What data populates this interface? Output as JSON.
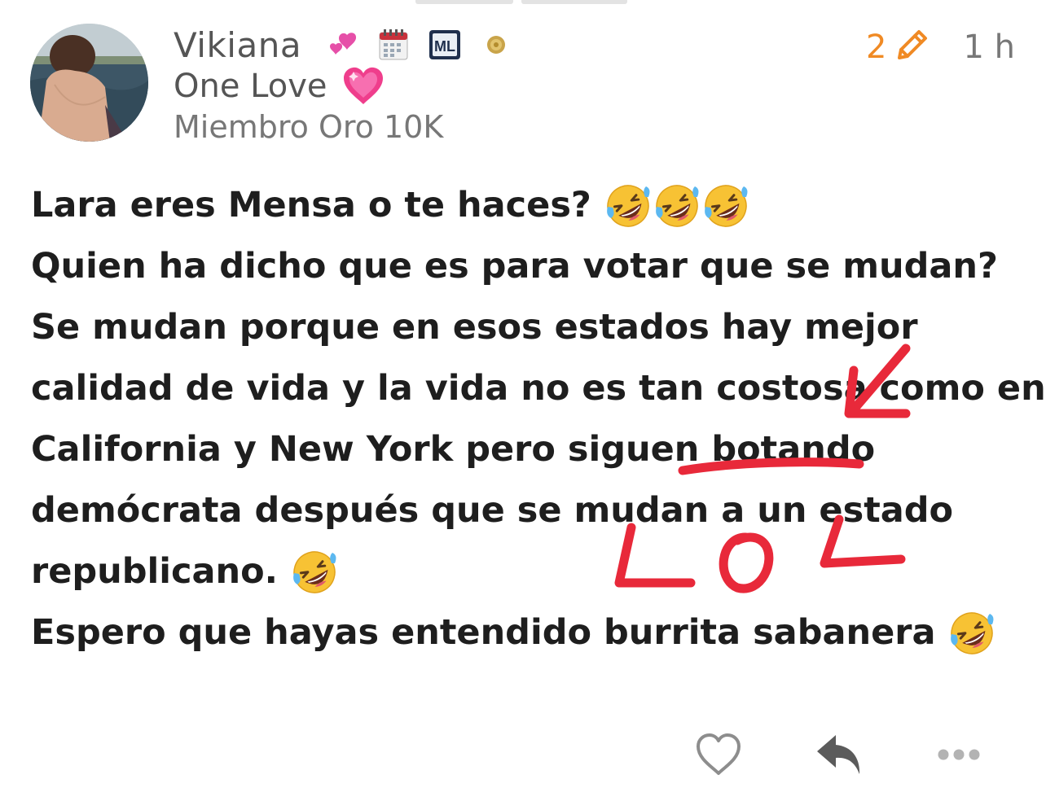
{
  "post": {
    "author": {
      "name": "Vikiana",
      "tagline": "One Love",
      "rank": "Miembro Oro 10K",
      "badges": [
        "two-hearts-icon",
        "calendar-icon",
        "ml-badge-icon",
        "coin-icon"
      ],
      "badge_text_ml": "ML"
    },
    "edit_count": "2",
    "time_ago": "1 h",
    "lines": [
      "Lara eres Mensa o te haces?",
      "Quien ha dicho que es para votar que se mudan?",
      "Se mudan porque en esos estados hay mejor",
      "calidad de vida y la vida no es tan costosa como en",
      "California y New York pero siguen botando",
      "demócrata después que se mudan a un estado",
      "republicano.",
      "Espero que hayas entendido burrita sabanera"
    ],
    "line_emojis": [
      3,
      0,
      0,
      0,
      0,
      0,
      1,
      1
    ],
    "emoji_name": "rolling-on-floor-laughing-emoji",
    "annotation_text": "LOL",
    "colors": {
      "accent": "#f08a24",
      "annotation": "#e8293a",
      "muted": "#777777"
    }
  },
  "actions": {
    "like": "heart-icon",
    "reply": "reply-icon",
    "more": "more-dots-icon"
  }
}
